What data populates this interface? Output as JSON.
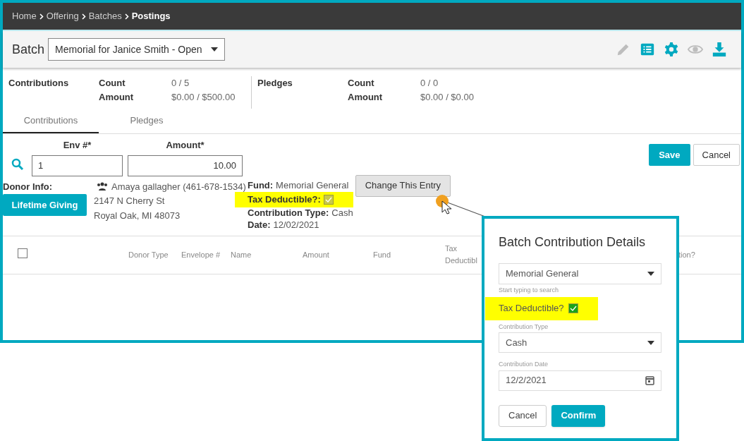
{
  "breadcrumb": [
    {
      "label": "Home",
      "current": false
    },
    {
      "label": "Offering",
      "current": false
    },
    {
      "label": "Batches",
      "current": false
    },
    {
      "label": "Postings",
      "current": true
    }
  ],
  "batch": {
    "label": "Batch",
    "value": "Memorial for Janice Smith - Open"
  },
  "toolbar": [
    {
      "kind": "edit",
      "disabled": true
    },
    {
      "kind": "list",
      "disabled": false
    },
    {
      "kind": "settings",
      "disabled": false
    },
    {
      "kind": "view",
      "disabled": true
    },
    {
      "kind": "download",
      "disabled": false
    }
  ],
  "summary": [
    {
      "title": "Contributions",
      "rows": [
        {
          "label": "Count",
          "value": "0 / 5"
        },
        {
          "label": "Amount",
          "value": "$0.00 / $500.00"
        }
      ]
    },
    {
      "title": "Pledges",
      "rows": [
        {
          "label": "Count",
          "value": "0 / 0"
        },
        {
          "label": "Amount",
          "value": "$0.00 / $0.00"
        }
      ]
    }
  ],
  "tabs": [
    {
      "label": "Contributions",
      "selected": true
    },
    {
      "label": "Pledges",
      "selected": false
    }
  ],
  "entry": {
    "env_label": "Env #*",
    "env_value": "1",
    "amount_label": "Amount*",
    "amount_value": "10.00"
  },
  "actions": [
    "Save",
    "Cancel"
  ],
  "donor": {
    "label": "Donor Info:",
    "button": "Lifetime Giving",
    "name": "Amaya gallagher (461-678-1534)",
    "address": [
      "2147 N Cherry St",
      "Royal Oak, MI 48073"
    ]
  },
  "details": [
    {
      "kind": "text",
      "label": "Fund:",
      "value": "Memorial General",
      "highlighted": false
    },
    {
      "kind": "checkbox",
      "label": "Tax Deductible?:",
      "checked": true,
      "highlighted": true
    },
    {
      "kind": "text",
      "label": "Contribution Type:",
      "value": "Cash",
      "highlighted": false
    },
    {
      "kind": "text",
      "label": "Date:",
      "value": "12/02/2021",
      "highlighted": false
    }
  ],
  "change_button": "Change This Entry",
  "table": {
    "select_all": {
      "checked": false
    },
    "columns": [
      "Donor Type",
      "Envelope #",
      "Name",
      "Amount",
      "Fund",
      "Tax Deductibl",
      "tion?"
    ]
  },
  "popup": {
    "title": "Batch Contribution Details",
    "fund_value": "Memorial General",
    "fund_hint": "Start typing to search",
    "tax_label": "Tax Deductible?",
    "tax_checked": true,
    "tax_highlighted": true,
    "type_label": "Contribution Type",
    "type_value": "Cash",
    "date_label": "Contribution Date",
    "date_value": "12/2/2021",
    "buttons": [
      "Cancel",
      "Confirm"
    ]
  }
}
